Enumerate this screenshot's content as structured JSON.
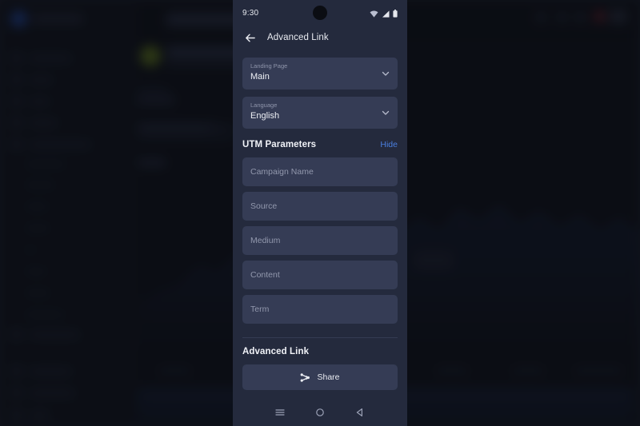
{
  "background": {
    "description": "dimmed blurred analytics dashboard behind modal",
    "accent": "#2f5fd0"
  },
  "phone": {
    "statusbar": {
      "clock": "9:30",
      "icons": [
        "wifi-icon",
        "cellular-signal-icon",
        "battery-icon"
      ]
    },
    "appbar": {
      "back_icon": "back-arrow-icon",
      "title": "Advanced Link"
    },
    "form": {
      "selects": [
        {
          "label": "Landing Page",
          "value": "Main",
          "chevron": "chevron-down-icon"
        },
        {
          "label": "Language",
          "value": "English",
          "chevron": "chevron-down-icon"
        }
      ],
      "utm": {
        "title": "UTM Parameters",
        "toggle_label": "Hide",
        "toggle_color": "#4a7fe0",
        "fields": [
          {
            "name": "campaign-name",
            "placeholder": "Campaign Name",
            "value": ""
          },
          {
            "name": "source",
            "placeholder": "Source",
            "value": ""
          },
          {
            "name": "medium",
            "placeholder": "Medium",
            "value": ""
          },
          {
            "name": "content",
            "placeholder": "Content",
            "value": ""
          },
          {
            "name": "term",
            "placeholder": "Term",
            "value": ""
          }
        ]
      },
      "advanced": {
        "title": "Advanced Link",
        "share_label": "Share",
        "share_icon": "share-icon"
      }
    },
    "navbar": {
      "recents_icon": "recents-menu-icon",
      "home_icon": "home-circle-icon",
      "back_icon": "back-triangle-icon"
    }
  }
}
